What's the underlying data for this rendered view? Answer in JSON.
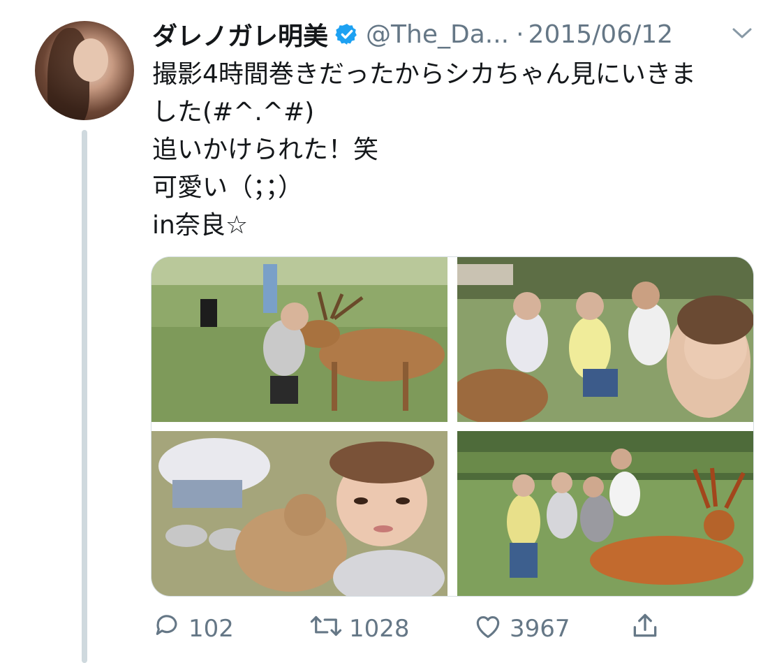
{
  "author": {
    "display_name": "ダレノガレ明美",
    "handle": "@The_Da...",
    "separator": "·",
    "date": "2015/06/12",
    "verified": true,
    "verified_color": "#1da1f2"
  },
  "tweet": {
    "lines": [
      "撮影4時間巻きだったからシカちゃん見にいきま",
      "した(#^.^#)",
      "追いかけられた！笑",
      "可愛い（；；）",
      "in奈良☆"
    ]
  },
  "media": {
    "photos": [
      {
        "subject": "woman-selfie-with-deer"
      },
      {
        "subject": "group-selfie-with-deer"
      },
      {
        "subject": "closeup-with-fawn"
      },
      {
        "subject": "group-posing-with-deer"
      }
    ]
  },
  "actions": {
    "reply": {
      "icon": "reply-icon",
      "count": "102"
    },
    "retweet": {
      "icon": "retweet-icon",
      "count": "1028"
    },
    "like": {
      "icon": "heart-icon",
      "count": "3967"
    },
    "share": {
      "icon": "share-icon"
    }
  },
  "colors": {
    "text": "#14171a",
    "secondary": "#657786",
    "thread_line": "#cfd9de",
    "accent": "#1da1f2"
  }
}
